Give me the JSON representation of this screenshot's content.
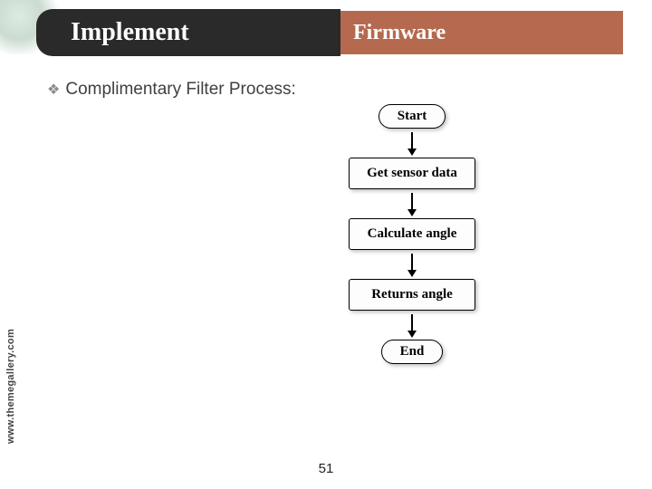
{
  "header": {
    "left_title": "Implement",
    "right_title": "Firmware"
  },
  "bullet": {
    "text": "Complimentary Filter Process:"
  },
  "flowchart": {
    "nodes": [
      {
        "label": "Start",
        "type": "terminal"
      },
      {
        "label": "Get sensor data",
        "type": "process"
      },
      {
        "label": "Calculate angle",
        "type": "process"
      },
      {
        "label": "Returns angle",
        "type": "process"
      },
      {
        "label": "End",
        "type": "terminal"
      }
    ]
  },
  "sidebar": {
    "url": "www.themegallery.com"
  },
  "page": {
    "number": "51"
  }
}
